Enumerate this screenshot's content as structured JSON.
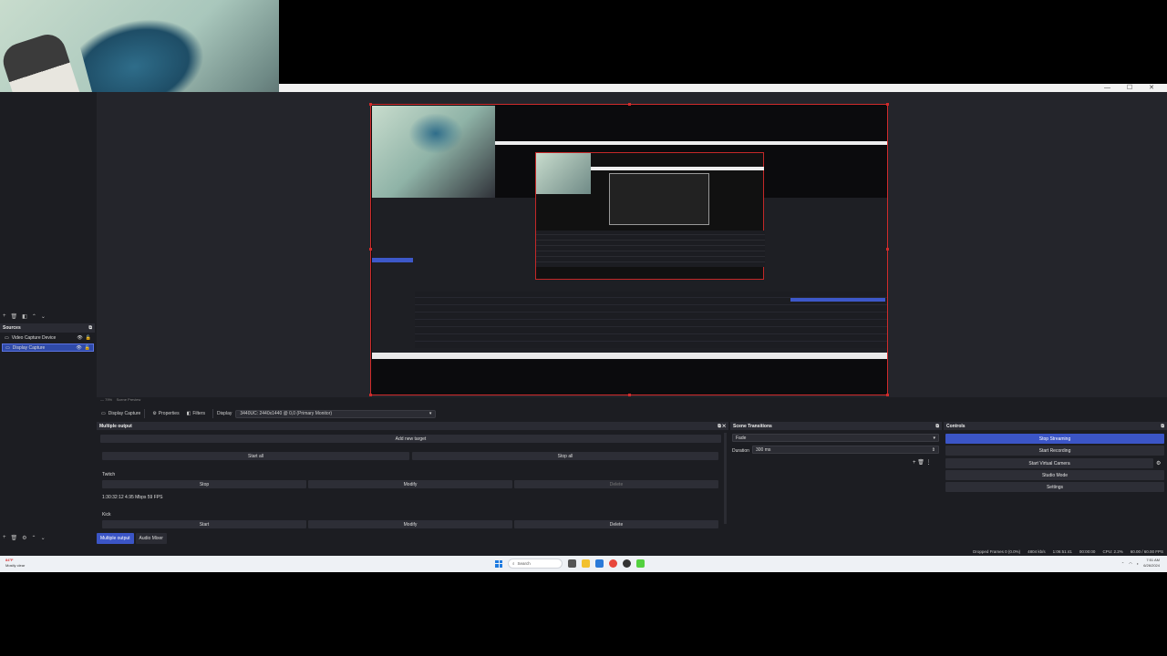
{
  "window": {
    "controls": "— ☐ ✕"
  },
  "preview_status": {
    "left": "— 79%",
    "right": "Scene Preview"
  },
  "source_toolbar": {
    "current_source": "Display Capture",
    "properties": "Properties",
    "filters": "Filters",
    "display_label": "Display",
    "display_value": "3440UC: 2440x1440 @ 0,0 (Primary Monitor)"
  },
  "sources_dock": {
    "title": "Sources",
    "items": [
      {
        "label": "Video Capture Device",
        "selected": false
      },
      {
        "label": "Display Capture",
        "selected": true
      }
    ]
  },
  "multiple_output": {
    "title": "Multiple output",
    "add_target": "Add new target",
    "start_all": "Start all",
    "stop_all": "Stop all",
    "targets": [
      {
        "name": "Twitch",
        "btn1": "Stop",
        "btn2": "Modify",
        "btn3": "Delete",
        "stats": "1:30:32:12 4.95 Mbps 59 FPS"
      },
      {
        "name": "Kick",
        "btn1": "Start",
        "btn2": "Modify",
        "btn3": "Delete"
      }
    ]
  },
  "scene_transitions": {
    "title": "Scene Transitions",
    "transition": "Fade",
    "duration_label": "Duration",
    "duration_value": "300 ms"
  },
  "controls": {
    "title": "Controls",
    "stop_streaming": "Stop Streaming",
    "start_recording": "Start Recording",
    "start_virtual_camera": "Start Virtual Camera",
    "studio_mode": "Studio Mode",
    "settings": "Settings"
  },
  "dock_tabs": [
    {
      "label": "Multiple output",
      "active": true
    },
    {
      "label": "Audio Mixer",
      "active": false
    }
  ],
  "status_bar": {
    "dropped": "Dropped Frames 0 (0.0%)",
    "bitrate": "4804 kb/s",
    "time1": "1:06:51:41",
    "time2": "00:00:00",
    "cpu": "CPU: 2.2%",
    "fps": "60.00 / 60.00 FPS"
  },
  "taskbar": {
    "weather_temp": "84°F",
    "weather_desc": "Mostly clear",
    "search": "Search",
    "time": "7:51 AM",
    "date": "6/26/2024"
  },
  "colors": {
    "accent": "#3b55c6",
    "selection_border": "#d12b2b",
    "panel": "#1c1d22"
  }
}
